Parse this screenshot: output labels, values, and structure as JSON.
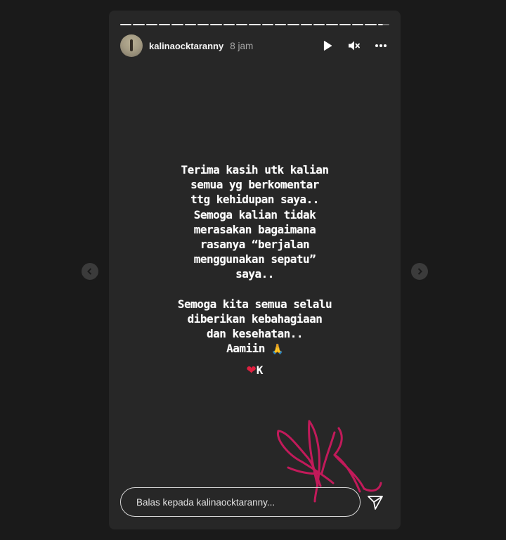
{
  "story": {
    "username": "kalinaocktaranny",
    "time": "8 jam",
    "segment_count": 21,
    "text": "Terima kasih utk kalian\nsemua yg berkomentar\nttg kehidupan saya..\nSemoga kalian tidak\nmerasakan bagaimana\nrasanya “berjalan\nmenggunakan sepatu”\nsaya..\n\nSemoga kita semua selalu\ndiberikan kebahagiaan\ndan kesehatan..\nAamiin",
    "pray_emoji": "🙏",
    "heart_emoji": "❤",
    "sign_letter": "K"
  },
  "controls": {
    "play_icon": "play-icon",
    "mute_icon": "muted-speaker-icon",
    "more_icon": "more-horizontal-icon"
  },
  "reply": {
    "placeholder": "Balas kepada kalinaocktaranny..."
  },
  "colors": {
    "background": "#1a1a1a",
    "story_bg": "#272727",
    "signature": "#c21a5a"
  }
}
